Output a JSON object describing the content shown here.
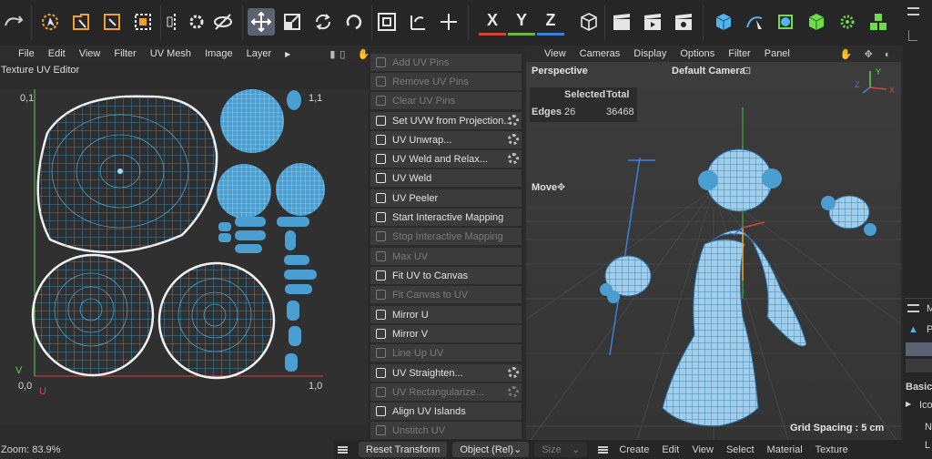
{
  "toolbar": {
    "axis_x": "X",
    "axis_y": "Y",
    "axis_z": "Z",
    "colors": {
      "active": "#5c6272",
      "x": "#d0453a",
      "y": "#6fb343",
      "z": "#3d7fd9",
      "accent": "#4fb4ef"
    }
  },
  "uv_editor": {
    "menu": [
      "File",
      "Edit",
      "View",
      "Filter",
      "UV Mesh",
      "Image",
      "Layer"
    ],
    "title": "Texture UV Editor",
    "corner_tl": "0,1",
    "corner_tr": "1,1",
    "corner_bl": "0,0",
    "corner_br": "1,0",
    "axis_v": "V",
    "axis_u": "U",
    "zoom": "Zoom: 83.9%"
  },
  "commands": [
    {
      "label": "Add UV Pins",
      "enabled": false,
      "gear": false
    },
    {
      "label": "Remove UV Pins",
      "enabled": false,
      "gear": false
    },
    {
      "label": "Clear UV Pins",
      "enabled": false,
      "gear": false
    },
    {
      "label": "Set UVW from Projection...",
      "enabled": true,
      "gear": true
    },
    {
      "label": "UV Unwrap...",
      "enabled": true,
      "gear": true
    },
    {
      "label": "UV Weld and Relax...",
      "enabled": true,
      "gear": true
    },
    {
      "label": "UV Weld",
      "enabled": true,
      "gear": false
    },
    {
      "label": "UV Peeler",
      "enabled": true,
      "gear": false
    },
    {
      "label": "Start Interactive Mapping",
      "enabled": true,
      "gear": false
    },
    {
      "label": "Stop Interactive Mapping",
      "enabled": false,
      "gear": false
    },
    {
      "label": "Max UV",
      "enabled": false,
      "gear": false
    },
    {
      "label": "Fit UV to Canvas",
      "enabled": true,
      "gear": false
    },
    {
      "label": "Fit Canvas to UV",
      "enabled": false,
      "gear": false
    },
    {
      "label": "Mirror U",
      "enabled": true,
      "gear": false
    },
    {
      "label": "Mirror V",
      "enabled": true,
      "gear": false
    },
    {
      "label": "Line Up UV",
      "enabled": false,
      "gear": false
    },
    {
      "label": "UV Straighten...",
      "enabled": true,
      "gear": true
    },
    {
      "label": "UV Rectangularize...",
      "enabled": false,
      "gear": true
    },
    {
      "label": "Align UV Islands",
      "enabled": true,
      "gear": false
    },
    {
      "label": "Unstitch UV",
      "enabled": false,
      "gear": false
    }
  ],
  "viewport": {
    "menu": [
      "View",
      "Cameras",
      "Display",
      "Options",
      "Filter",
      "Panel"
    ],
    "projection": "Perspective",
    "camera": "Default Camera",
    "hud": {
      "selected": "Selected",
      "total": "Total",
      "row_label": "Edges",
      "row_selected": "26",
      "row_total": "36468"
    },
    "tool": "Move",
    "grid_spacing": "Grid Spacing : 5 cm"
  },
  "bottom": {
    "reset": "Reset Transform",
    "coord": "Object (Rel)",
    "size": "Size",
    "menu": [
      "Create",
      "Edit",
      "View",
      "Select",
      "Material",
      "Texture"
    ]
  },
  "right": {
    "basic": "Basic",
    "ico": "Ico",
    "n": "N",
    "l": "L",
    "m": "M",
    "p": "P"
  }
}
